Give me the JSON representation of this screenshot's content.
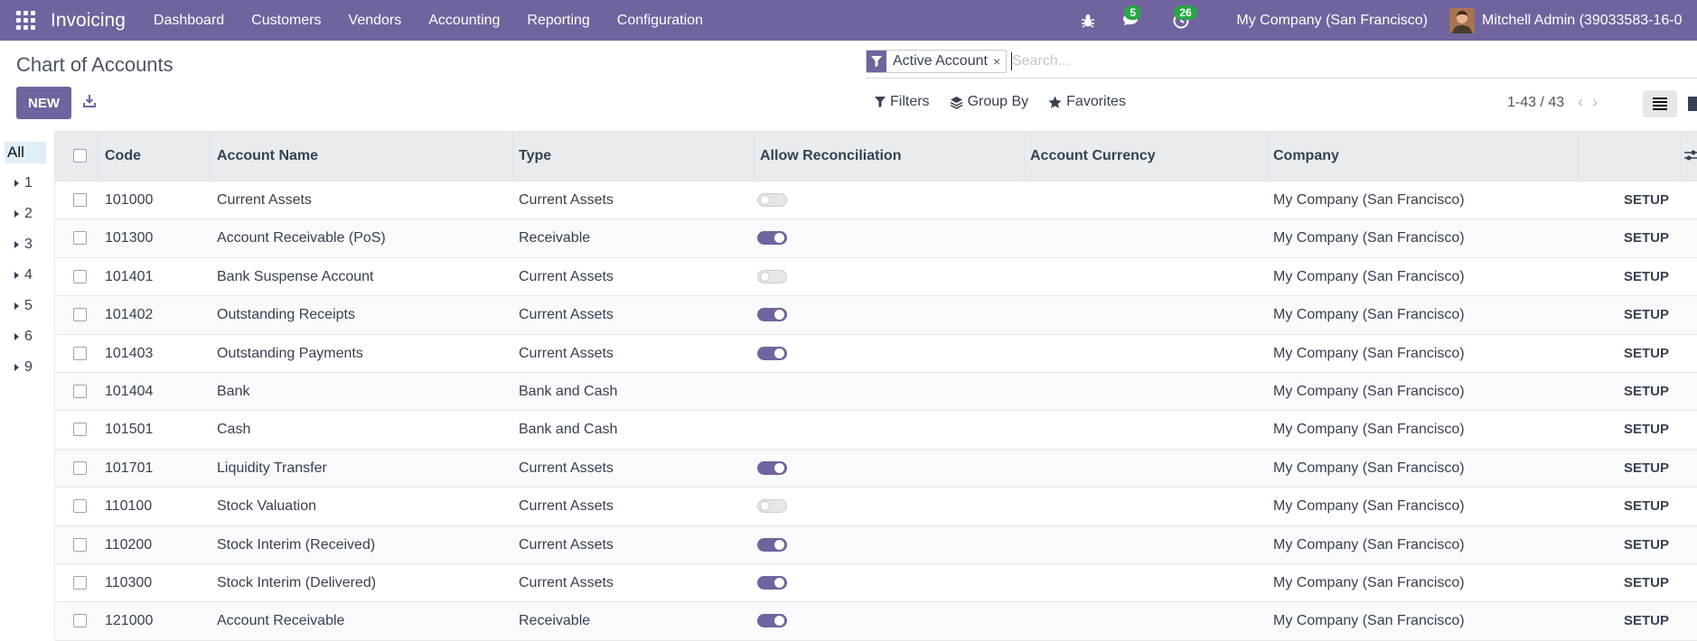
{
  "navbar": {
    "app_name": "Invoicing",
    "menu": [
      "Dashboard",
      "Customers",
      "Vendors",
      "Accounting",
      "Reporting",
      "Configuration"
    ],
    "messages_badge": "5",
    "activities_badge": "26",
    "company": "My Company (San Francisco)",
    "user": "Mitchell Admin (39033583-16-0"
  },
  "control": {
    "title": "Chart of Accounts",
    "new_label": "NEW",
    "facet_label": "Active Account",
    "facet_close": "×",
    "search_placeholder": "Search...",
    "filters_label": "Filters",
    "groupby_label": "Group By",
    "favorites_label": "Favorites",
    "pager": "1-43 / 43"
  },
  "side_panel": {
    "all_label": "All",
    "items": [
      "1",
      "2",
      "3",
      "4",
      "5",
      "6",
      "9"
    ]
  },
  "table": {
    "columns": [
      "Code",
      "Account Name",
      "Type",
      "Allow Reconciliation",
      "Account Currency",
      "Company"
    ],
    "setup_label": "SETUP",
    "rows": [
      {
        "code": "101000",
        "name": "Current Assets",
        "type": "Current Assets",
        "reconcile": "off",
        "currency": "",
        "company": "My Company (San Francisco)"
      },
      {
        "code": "101300",
        "name": "Account Receivable (PoS)",
        "type": "Receivable",
        "reconcile": "on",
        "currency": "",
        "company": "My Company (San Francisco)"
      },
      {
        "code": "101401",
        "name": "Bank Suspense Account",
        "type": "Current Assets",
        "reconcile": "off",
        "currency": "",
        "company": "My Company (San Francisco)"
      },
      {
        "code": "101402",
        "name": "Outstanding Receipts",
        "type": "Current Assets",
        "reconcile": "on",
        "currency": "",
        "company": "My Company (San Francisco)"
      },
      {
        "code": "101403",
        "name": "Outstanding Payments",
        "type": "Current Assets",
        "reconcile": "on",
        "currency": "",
        "company": "My Company (San Francisco)"
      },
      {
        "code": "101404",
        "name": "Bank",
        "type": "Bank and Cash",
        "reconcile": "none",
        "currency": "",
        "company": "My Company (San Francisco)"
      },
      {
        "code": "101501",
        "name": "Cash",
        "type": "Bank and Cash",
        "reconcile": "none",
        "currency": "",
        "company": "My Company (San Francisco)"
      },
      {
        "code": "101701",
        "name": "Liquidity Transfer",
        "type": "Current Assets",
        "reconcile": "on",
        "currency": "",
        "company": "My Company (San Francisco)"
      },
      {
        "code": "110100",
        "name": "Stock Valuation",
        "type": "Current Assets",
        "reconcile": "off",
        "currency": "",
        "company": "My Company (San Francisco)"
      },
      {
        "code": "110200",
        "name": "Stock Interim (Received)",
        "type": "Current Assets",
        "reconcile": "on",
        "currency": "",
        "company": "My Company (San Francisco)"
      },
      {
        "code": "110300",
        "name": "Stock Interim (Delivered)",
        "type": "Current Assets",
        "reconcile": "on",
        "currency": "",
        "company": "My Company (San Francisco)"
      },
      {
        "code": "121000",
        "name": "Account Receivable",
        "type": "Receivable",
        "reconcile": "on",
        "currency": "",
        "company": "My Company (San Francisco)"
      }
    ]
  }
}
